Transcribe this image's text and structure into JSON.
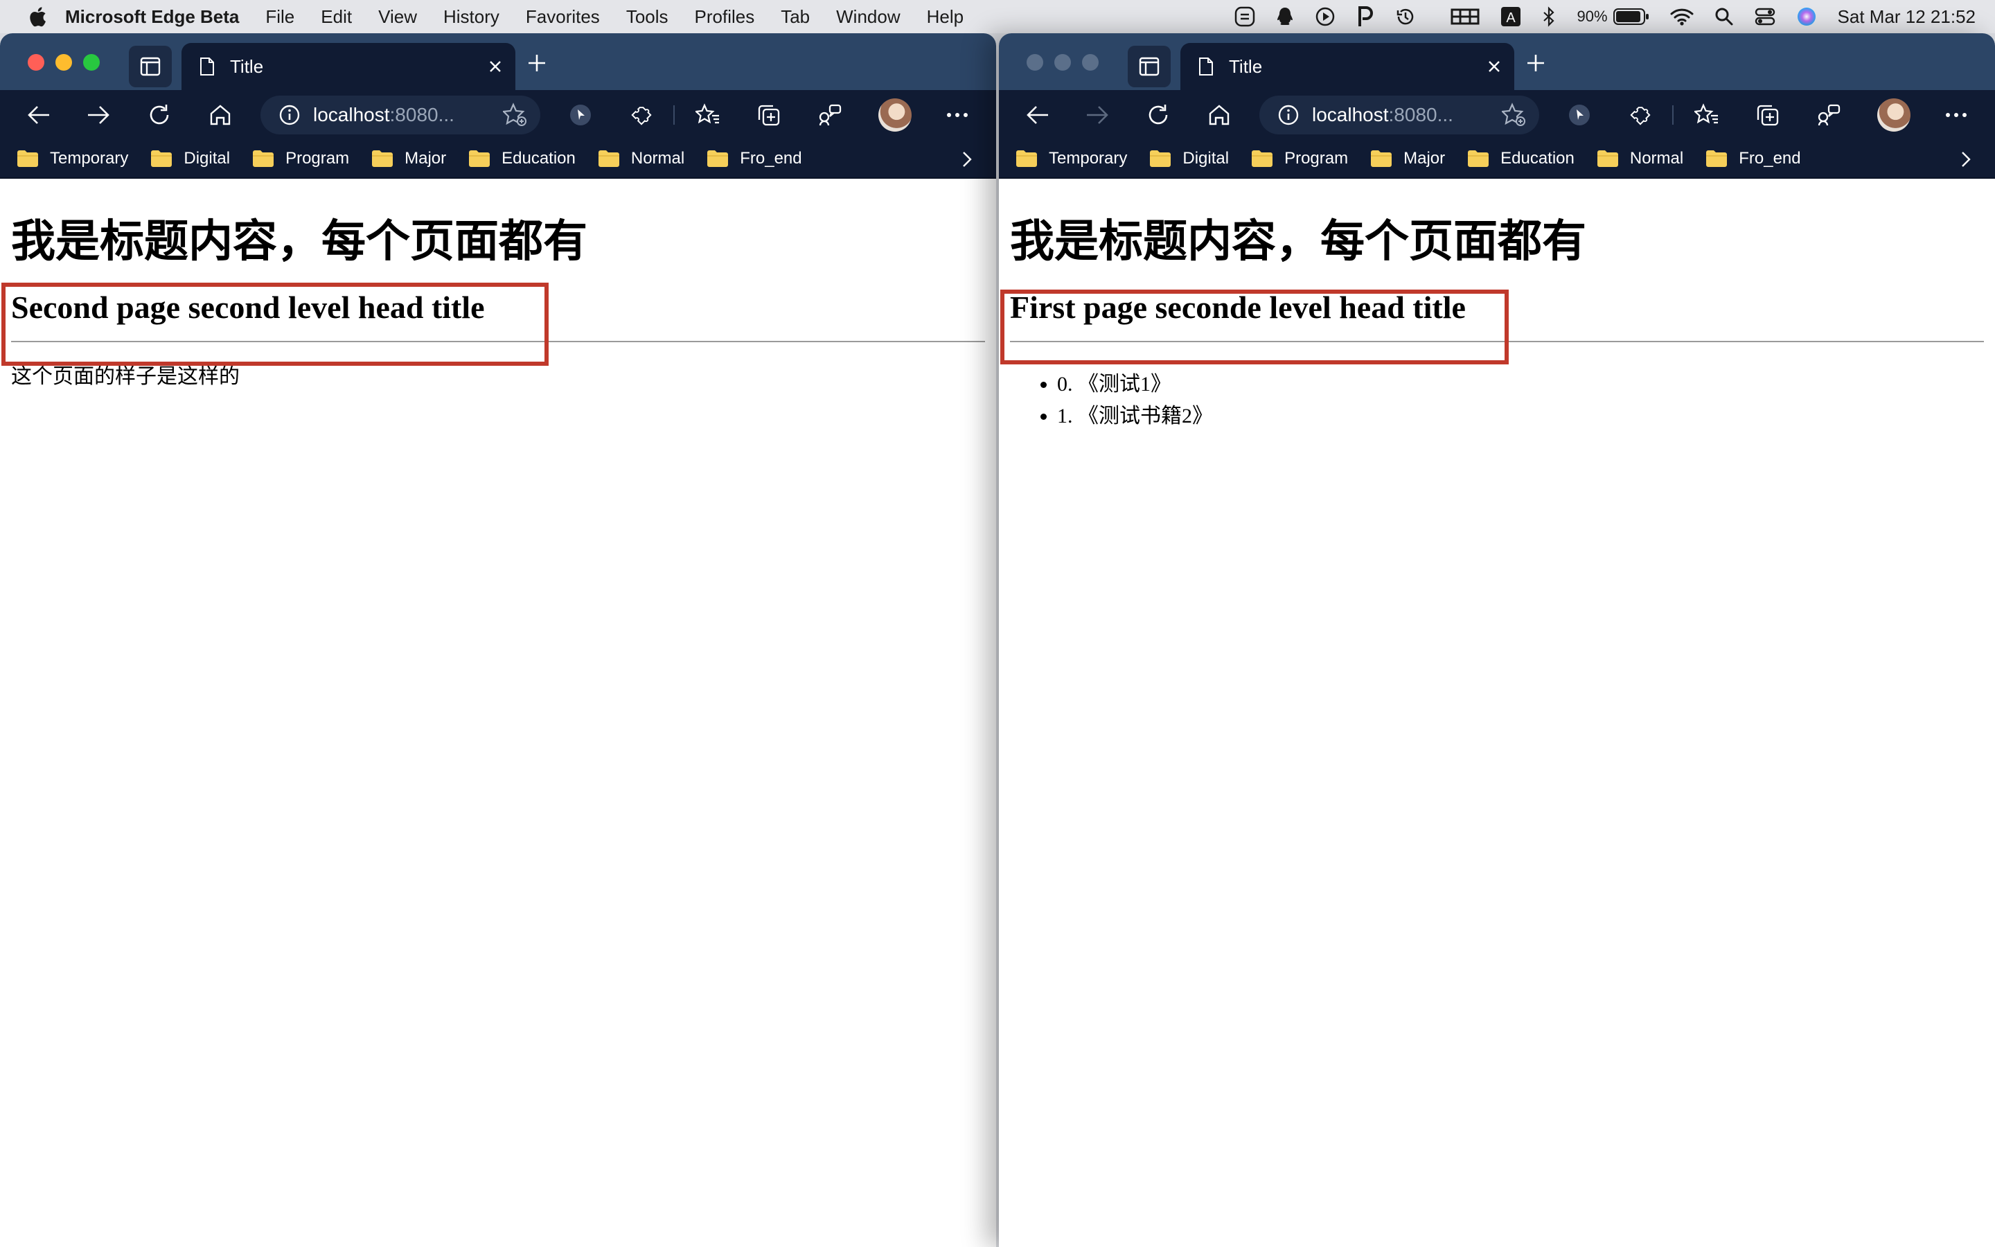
{
  "menubar": {
    "app_name": "Microsoft Edge Beta",
    "items": [
      "File",
      "Edit",
      "View",
      "History",
      "Favorites",
      "Tools",
      "Profiles",
      "Tab",
      "Window",
      "Help"
    ],
    "battery": "90%",
    "clock": "Sat Mar 12  21:52"
  },
  "windows": [
    {
      "tab_title": "Title",
      "address_host": "localhost",
      "address_rest": ":8080...",
      "bookmarks": [
        "Temporary",
        "Digital",
        "Program",
        "Major",
        "Education",
        "Normal",
        "Fro_end"
      ],
      "page": {
        "h1": "我是标题内容，每个页面都有",
        "h2": "Second page second level head title",
        "paragraph": "这个页面的样子是这样的"
      }
    },
    {
      "tab_title": "Title",
      "address_host": "localhost",
      "address_rest": ":8080...",
      "bookmarks": [
        "Temporary",
        "Digital",
        "Program",
        "Major",
        "Education",
        "Normal",
        "Fro_end"
      ],
      "page": {
        "h1": "我是标题内容，每个页面都有",
        "h2": "First page seconde level head title",
        "list": [
          "0. 《测试1》",
          "1. 《测试书籍2》"
        ]
      }
    }
  ],
  "colors": {
    "highlight_border": "#c0392b",
    "titlebar": "#2c4566",
    "toolbar": "#101b33",
    "folder": "#f6cf5a"
  },
  "icons": [
    "apple-icon",
    "back-icon",
    "forward-icon",
    "refresh-icon",
    "home-icon",
    "info-icon",
    "favorite-add-icon",
    "cursor-extension-icon",
    "extensions-icon",
    "favorites-icon",
    "collections-icon",
    "share-icon",
    "more-icon",
    "folder-icon",
    "chevron-right-icon",
    "page-icon",
    "close-icon",
    "new-tab-icon",
    "tab-actions-icon",
    "wifi-icon",
    "search-icon",
    "control-center-icon",
    "siri-icon",
    "bluetooth-icon",
    "battery-icon"
  ]
}
